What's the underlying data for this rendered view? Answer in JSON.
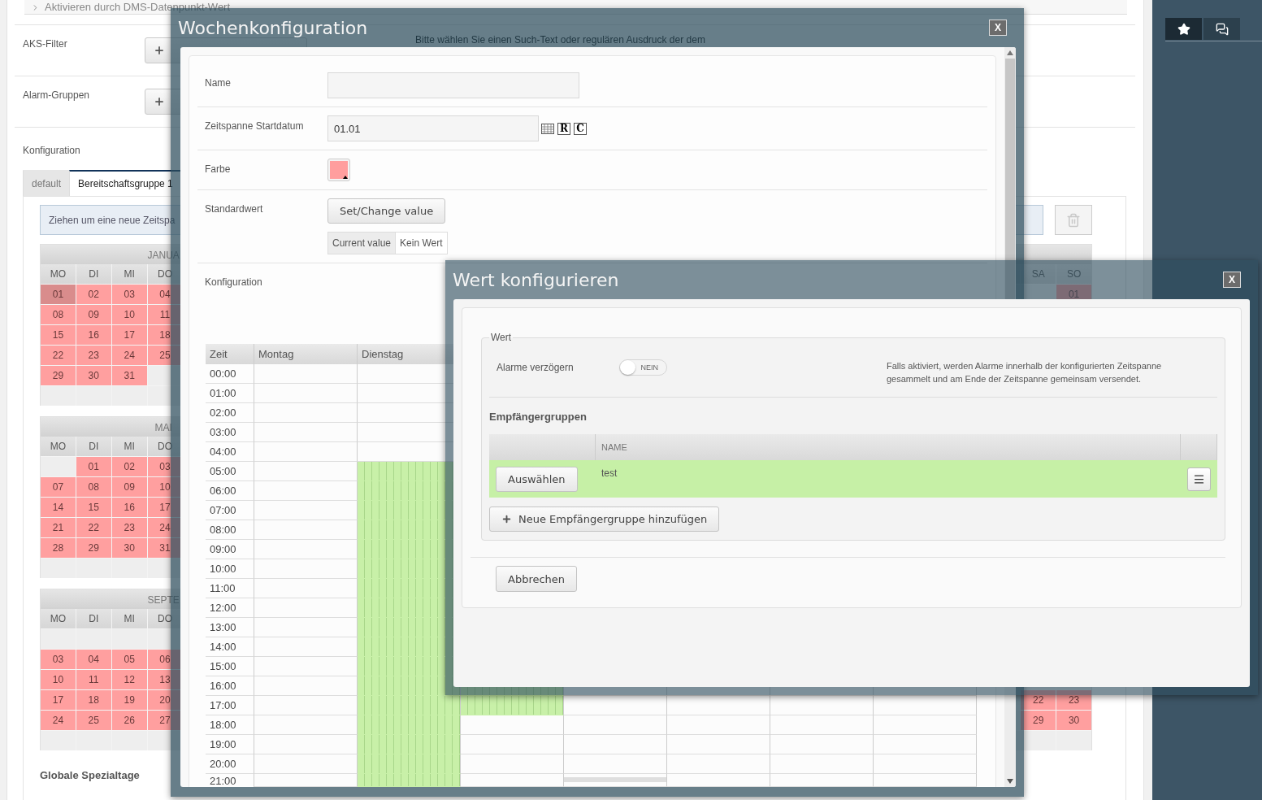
{
  "background": {
    "breadcrumb": "Aktivieren durch DMS-Datenpunkt-Wert",
    "sections": [
      {
        "label": "AKS-Filter",
        "hint": "Bitte wählen Sie einen Such-Text oder regulären Ausdruck der dem"
      },
      {
        "label": "Alarm-Gruppen"
      }
    ],
    "config_label": "Konfiguration",
    "tabs": [
      {
        "label": "default",
        "selected": false
      },
      {
        "label": "Bereitschaftsgruppe 1",
        "selected": true
      }
    ],
    "drop_hint": "Ziehen um eine neue Zeitspa",
    "calendar_rows": [
      {
        "left": {
          "month": "JANUA",
          "weekdays": [
            "MO",
            "DI",
            "MI",
            "DO"
          ],
          "weeks": [
            [
              {
                "day": "01",
                "today": true
              },
              "02",
              "03",
              "04"
            ],
            [
              "08",
              "09",
              "10",
              "11"
            ],
            [
              "15",
              "16",
              "17",
              "18"
            ],
            [
              "22",
              "23",
              "24",
              "25"
            ],
            [
              "29",
              "30",
              "31"
            ]
          ]
        },
        "right": {
          "weekdays": [
            "SA",
            "SO"
          ],
          "weeks": [
            [
              "01"
            ]
          ]
        }
      },
      {
        "left": {
          "month": "MAI",
          "weekdays": [
            "MO",
            "DI",
            "MI",
            "DO"
          ],
          "weeks": [
            [
              "01",
              "02",
              "03"
            ],
            [
              "07",
              "08",
              "09",
              "10"
            ],
            [
              "14",
              "15",
              "16",
              "17"
            ],
            [
              "21",
              "22",
              "23",
              "24"
            ],
            [
              "28",
              "29",
              "30",
              "31"
            ]
          ]
        }
      },
      {
        "left": {
          "month": "SEPTE",
          "weekdays": [
            "MO",
            "DI",
            "MI",
            "DO"
          ],
          "leading_blank_week": true,
          "weeks": [
            [
              "03",
              "04",
              "05",
              "06"
            ],
            [
              "10",
              "11",
              "12",
              "13"
            ],
            [
              "17",
              "18",
              "19",
              "20"
            ],
            [
              "24",
              "25",
              "26",
              "27"
            ]
          ]
        },
        "right": {
          "weeks": [
            [
              "22",
              "23"
            ],
            [
              "29",
              "30"
            ]
          ]
        }
      }
    ],
    "special_days_title": "Globale Spezialtage"
  },
  "sidebar_tabs": [
    {
      "kind": "star",
      "selected": true
    },
    {
      "kind": "chat",
      "selected": false
    }
  ],
  "week_dialog": {
    "title": "Wochenkonfiguration",
    "close": "X",
    "fields": [
      {
        "kind": "text",
        "label": "Name"
      },
      {
        "kind": "date",
        "label": "Zeitspanne Startdatum",
        "value": "01.01",
        "buttons": [
          "R",
          "C"
        ]
      },
      {
        "kind": "color",
        "label": "Farbe",
        "color": "#ff9e9e"
      },
      {
        "kind": "value",
        "label": "Standardwert",
        "button": "Set/Change value",
        "current_label": "Current value",
        "current_value": "Kein Wert"
      }
    ],
    "schedule": {
      "label": "Konfiguration",
      "columns": [
        "Zeit",
        "Montag",
        "Dienstag"
      ],
      "rows": [
        {
          "time": "00:00",
          "busy": [
            false,
            false
          ]
        },
        {
          "time": "01:00",
          "busy": [
            false,
            false
          ]
        },
        {
          "time": "02:00",
          "busy": [
            false,
            false
          ]
        },
        {
          "time": "03:00",
          "busy": [
            false,
            false
          ]
        },
        {
          "time": "04:00",
          "busy": [
            false,
            false
          ]
        },
        {
          "time": "05:00",
          "busy": [
            false,
            true
          ]
        },
        {
          "time": "06:00",
          "busy": [
            false,
            true
          ]
        },
        {
          "time": "07:00",
          "busy": [
            false,
            true
          ]
        },
        {
          "time": "08:00",
          "busy": [
            false,
            true
          ]
        },
        {
          "time": "09:00",
          "busy": [
            false,
            true
          ]
        },
        {
          "time": "10:00",
          "busy": [
            false,
            true
          ]
        },
        {
          "time": "11:00",
          "busy": [
            false,
            true
          ]
        },
        {
          "time": "12:00",
          "busy": [
            false,
            true
          ]
        },
        {
          "time": "13:00",
          "busy": [
            false,
            true
          ]
        },
        {
          "time": "14:00",
          "busy": [
            false,
            true
          ]
        },
        {
          "time": "15:00",
          "busy": [
            false,
            true
          ]
        },
        {
          "time": "16:00",
          "busy": [
            false,
            true,
            true,
            false,
            false,
            false,
            false
          ]
        },
        {
          "time": "17:00",
          "busy": [
            false,
            true,
            true,
            false,
            false,
            false,
            false
          ]
        },
        {
          "time": "18:00",
          "busy": [
            false,
            true,
            false,
            false,
            false,
            false,
            false
          ]
        },
        {
          "time": "19:00",
          "busy": [
            false,
            true,
            false,
            false,
            false,
            false,
            false
          ]
        },
        {
          "time": "20:00",
          "busy": [
            false,
            true,
            false,
            false,
            false,
            false,
            false
          ]
        },
        {
          "time": "21:00",
          "busy": [
            false,
            true,
            false,
            false,
            false,
            false,
            false
          ],
          "pending": [
            false,
            false,
            false,
            true,
            false,
            false,
            false
          ]
        }
      ]
    }
  },
  "value_dialog": {
    "title": "Wert konfigurieren",
    "close": "X",
    "group_title": "Wert",
    "delay": {
      "label": "Alarme verzögern",
      "on": false,
      "state_text": "NEIN",
      "help": "Falls aktiviert, werden Alarme innerhalb der konfigurierten Zeitspanne gesammelt und am Ende der Zeitspanne gemeinsam versendet."
    },
    "recipients": {
      "title": "Empfängergruppen",
      "columns": [
        "NAME"
      ],
      "rows": [
        {
          "select": "Auswählen",
          "name": "test",
          "selected": true
        }
      ],
      "add": "Neue Empfängergruppe hinzufügen"
    },
    "cancel": "Abbrechen"
  }
}
